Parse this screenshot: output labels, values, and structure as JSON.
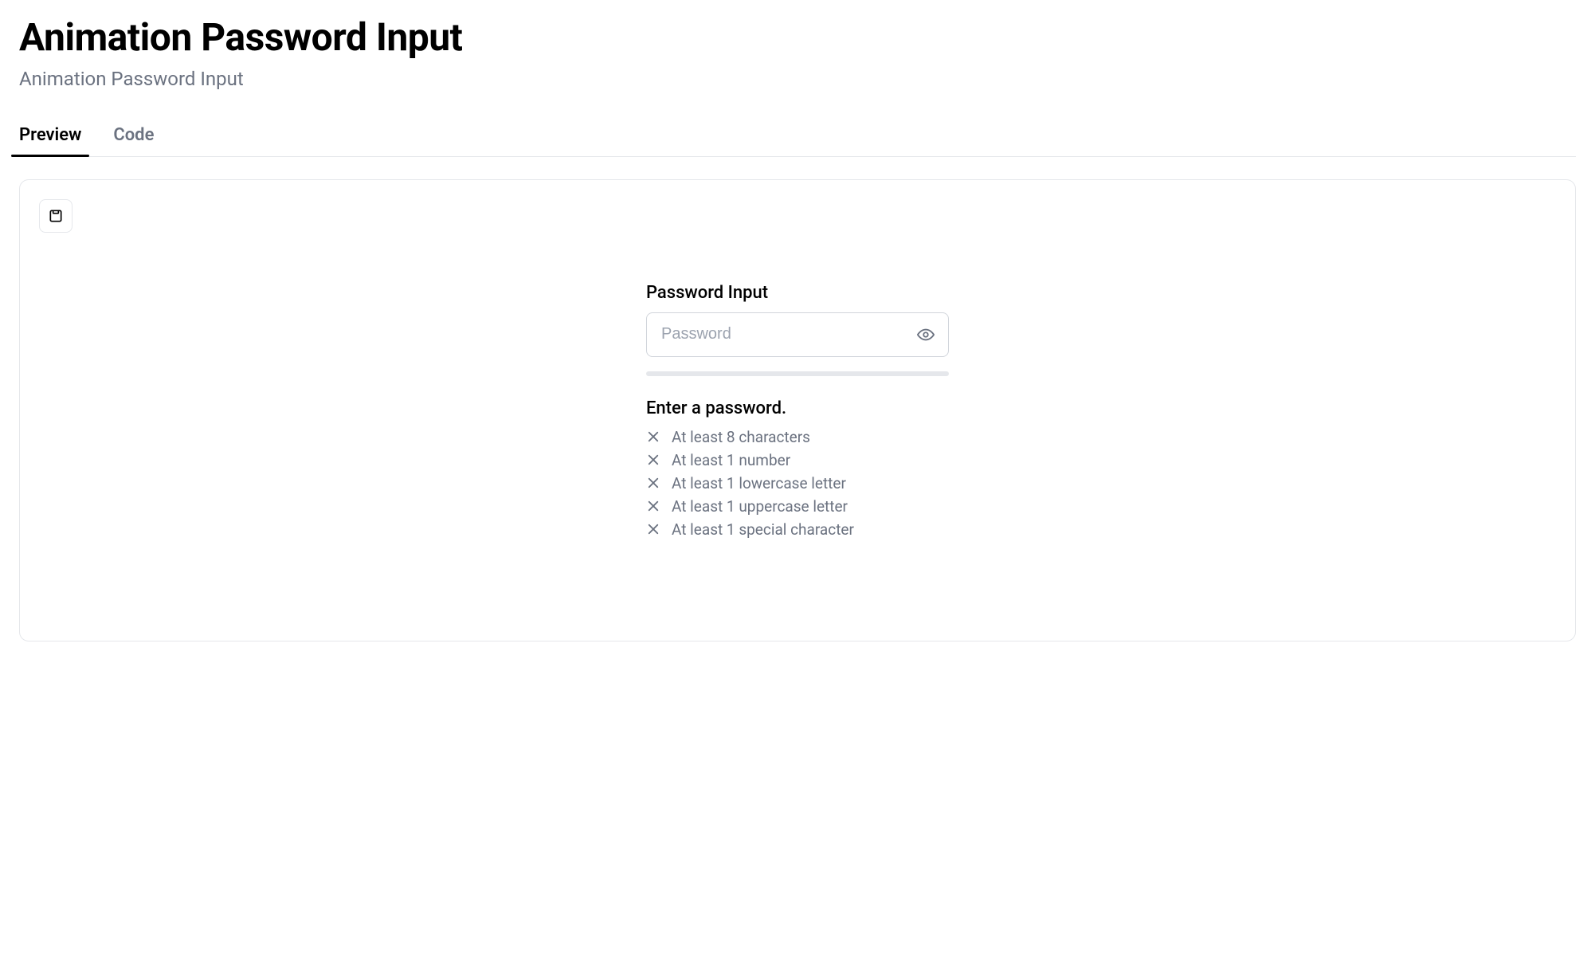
{
  "header": {
    "title": "Animation Password Input",
    "subtitle": "Animation Password Input"
  },
  "tabs": {
    "preview": "Preview",
    "code": "Code"
  },
  "widget": {
    "label": "Password Input",
    "placeholder": "Password",
    "value": "",
    "prompt": "Enter a password.",
    "requirements": [
      "At least 8 characters",
      "At least 1 number",
      "At least 1 lowercase letter",
      "At least 1 uppercase letter",
      "At least 1 special character"
    ]
  }
}
